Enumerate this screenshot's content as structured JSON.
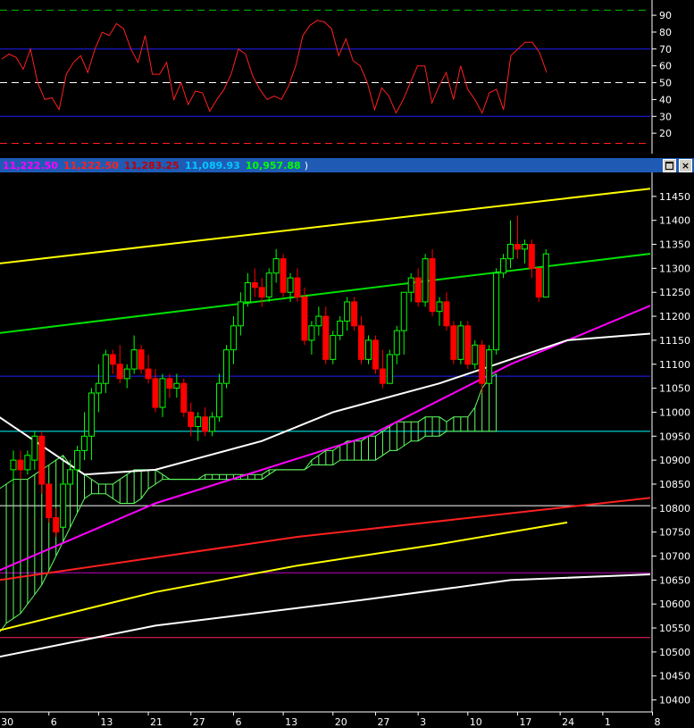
{
  "window": {
    "header_values": [
      {
        "text": "11,222.50",
        "color": "#ff00ff"
      },
      {
        "text": "11,222.50",
        "color": "#ff2020"
      },
      {
        "text": "11,283.25",
        "color": "#c00000"
      },
      {
        "text": "11,089.93",
        "color": "#00c8ff"
      },
      {
        "text": "10,957.88",
        "color": "#00ff00"
      }
    ],
    "header_close": ")",
    "maximize_icon": "maximize-icon",
    "close_icon": "close-icon"
  },
  "chart_data": [
    {
      "type": "line",
      "panel": "oscillator",
      "ylim": [
        10,
        98
      ],
      "yticks": [
        20,
        30,
        40,
        50,
        60,
        70,
        80,
        90
      ],
      "reference_lines": [
        {
          "y": 93,
          "color": "#00c000",
          "style": "dashed"
        },
        {
          "y": 70,
          "color": "#2020ff",
          "style": "solid"
        },
        {
          "y": 50,
          "color": "#ffffff",
          "style": "dashed"
        },
        {
          "y": 30,
          "color": "#2020ff",
          "style": "solid"
        },
        {
          "y": 14,
          "color": "#ff2020",
          "style": "dashed"
        }
      ],
      "series": [
        {
          "color": "#ff2020",
          "values": [
            64,
            67,
            65,
            58,
            70,
            50,
            40,
            41,
            34,
            55,
            62,
            66,
            56,
            70,
            80,
            78,
            85,
            82,
            70,
            62,
            78,
            55,
            55,
            62,
            40,
            50,
            37,
            45,
            44,
            33,
            40,
            46,
            55,
            70,
            67,
            54,
            46,
            40,
            42,
            40,
            48,
            60,
            78,
            84,
            87,
            86,
            82,
            66,
            76,
            63,
            60,
            50,
            34,
            47,
            42,
            32,
            40,
            50,
            60,
            60,
            38,
            48,
            56,
            40,
            60,
            46,
            40,
            32,
            44,
            46,
            34,
            66,
            70,
            74,
            74,
            68,
            56
          ]
        }
      ]
    },
    {
      "type": "candlestick",
      "panel": "price",
      "ylim": [
        10375,
        11500
      ],
      "yticks": [
        10400,
        10450,
        10500,
        10550,
        10600,
        10650,
        10700,
        10750,
        10800,
        10850,
        10900,
        10950,
        11000,
        11050,
        11100,
        11150,
        11200,
        11250,
        11300,
        11350,
        11400,
        11450
      ],
      "x_tick_labels": [
        "30",
        "6",
        "13",
        "21",
        "27",
        "6",
        "13",
        "20",
        "27",
        "3",
        "10",
        "17",
        "24",
        "1",
        "8"
      ],
      "x_tick_index": [
        -2,
        5,
        12,
        19,
        25,
        31,
        38,
        45,
        51,
        57,
        64,
        71,
        77,
        83,
        90
      ],
      "candles": [
        [
          10880,
          10920,
          10850,
          10900
        ],
        [
          10900,
          10920,
          10860,
          10880
        ],
        [
          10880,
          10920,
          10870,
          10910
        ],
        [
          10900,
          10960,
          10880,
          10950
        ],
        [
          10950,
          10960,
          10830,
          10850
        ],
        [
          10850,
          10850,
          10770,
          10780
        ],
        [
          10780,
          10800,
          10740,
          10750
        ],
        [
          10760,
          10860,
          10760,
          10850
        ],
        [
          10850,
          10900,
          10840,
          10880
        ],
        [
          10880,
          10930,
          10870,
          10920
        ],
        [
          10920,
          11000,
          10900,
          10950
        ],
        [
          10950,
          11050,
          10900,
          11040
        ],
        [
          11040,
          11100,
          11000,
          11060
        ],
        [
          11060,
          11130,
          11040,
          11120
        ],
        [
          11120,
          11130,
          11080,
          11100
        ],
        [
          11100,
          11140,
          11060,
          11070
        ],
        [
          11070,
          11100,
          11050,
          11090
        ],
        [
          11090,
          11160,
          11080,
          11130
        ],
        [
          11130,
          11140,
          11080,
          11090
        ],
        [
          11090,
          11120,
          11060,
          11070
        ],
        [
          11070,
          11090,
          11000,
          11010
        ],
        [
          11010,
          11080,
          10990,
          11070
        ],
        [
          11070,
          11080,
          11030,
          11050
        ],
        [
          11050,
          11080,
          11030,
          11060
        ],
        [
          11060,
          11070,
          10990,
          11000
        ],
        [
          11000,
          11020,
          10950,
          10970
        ],
        [
          10970,
          11000,
          10940,
          10990
        ],
        [
          10990,
          11010,
          10950,
          10960
        ],
        [
          10960,
          11000,
          10950,
          10990
        ],
        [
          10990,
          11080,
          10980,
          11060
        ],
        [
          11060,
          11140,
          11050,
          11130
        ],
        [
          11130,
          11200,
          11100,
          11180
        ],
        [
          11180,
          11250,
          11160,
          11230
        ],
        [
          11230,
          11290,
          11220,
          11270
        ],
        [
          11270,
          11300,
          11240,
          11260
        ],
        [
          11260,
          11280,
          11220,
          11240
        ],
        [
          11240,
          11300,
          11230,
          11290
        ],
        [
          11290,
          11340,
          11270,
          11320
        ],
        [
          11320,
          11330,
          11240,
          11250
        ],
        [
          11250,
          11290,
          11230,
          11280
        ],
        [
          11280,
          11300,
          11230,
          11240
        ],
        [
          11240,
          11260,
          11140,
          11150
        ],
        [
          11150,
          11190,
          11120,
          11180
        ],
        [
          11180,
          11220,
          11160,
          11200
        ],
        [
          11200,
          11220,
          11100,
          11110
        ],
        [
          11110,
          11170,
          11100,
          11160
        ],
        [
          11160,
          11200,
          11150,
          11190
        ],
        [
          11190,
          11240,
          11170,
          11230
        ],
        [
          11230,
          11240,
          11170,
          11180
        ],
        [
          11180,
          11200,
          11100,
          11110
        ],
        [
          11110,
          11160,
          11100,
          11150
        ],
        [
          11150,
          11160,
          11080,
          11090
        ],
        [
          11090,
          11130,
          11050,
          11060
        ],
        [
          11060,
          11130,
          11060,
          11120
        ],
        [
          11120,
          11180,
          11100,
          11170
        ],
        [
          11170,
          11210,
          11120,
          11250
        ],
        [
          11250,
          11290,
          11230,
          11280
        ],
        [
          11280,
          11300,
          11220,
          11230
        ],
        [
          11230,
          11330,
          11220,
          11320
        ],
        [
          11320,
          11340,
          11200,
          11210
        ],
        [
          11210,
          11240,
          11180,
          11230
        ],
        [
          11230,
          11250,
          11170,
          11180
        ],
        [
          11180,
          11190,
          11100,
          11110
        ],
        [
          11110,
          11190,
          11100,
          11180
        ],
        [
          11180,
          11190,
          11090,
          11100
        ],
        [
          11100,
          11150,
          11090,
          11140
        ],
        [
          11140,
          11150,
          11040,
          11060
        ],
        [
          11060,
          11140,
          11060,
          11130
        ],
        [
          11130,
          11300,
          11120,
          11290
        ],
        [
          11290,
          11330,
          11280,
          11320
        ],
        [
          11320,
          11400,
          11300,
          11350
        ],
        [
          11350,
          11410,
          11320,
          11340
        ],
        [
          11340,
          11360,
          11310,
          11350
        ],
        [
          11350,
          11360,
          11280,
          11300
        ],
        [
          11300,
          11300,
          11230,
          11240
        ],
        [
          11240,
          11340,
          11260,
          11330
        ]
      ],
      "lines": [
        {
          "name_color": "#ffff00",
          "width": 2,
          "points": [
            [
              -2,
              10545
            ],
            [
              20,
              10625
            ],
            [
              40,
              10680
            ],
            [
              60,
              10725
            ],
            [
              78,
              10770
            ]
          ]
        },
        {
          "name_color": "#ffffff",
          "width": 2,
          "points": [
            [
              -2,
              10490
            ],
            [
              20,
              10555
            ],
            [
              50,
              10610
            ],
            [
              70,
              10650
            ],
            [
              95,
              10665
            ]
          ]
        },
        {
          "name_color": "#ff2020",
          "width": 2,
          "points": [
            [
              -2,
              10650
            ],
            [
              40,
              10740
            ],
            [
              95,
              10830
            ]
          ]
        },
        {
          "name_color": "#ff00ff",
          "width": 2,
          "points": [
            [
              -2,
              10670
            ],
            [
              20,
              10810
            ],
            [
              50,
              10950
            ],
            [
              70,
              11100
            ],
            [
              95,
              11255
            ]
          ]
        },
        {
          "name_color": "#00e000",
          "width": 2,
          "points": [
            [
              -2,
              11165
            ],
            [
              95,
              11340
            ]
          ]
        },
        {
          "name_color": "#ffff00",
          "width": 2,
          "points": [
            [
              -2,
              11310
            ],
            [
              95,
              11475
            ]
          ]
        },
        {
          "name_color": "#ffffff",
          "width": 2,
          "points": [
            [
              -2,
              10990
            ],
            [
              10,
              10870
            ],
            [
              20,
              10880
            ],
            [
              35,
              10940
            ],
            [
              45,
              11000
            ],
            [
              60,
              11060
            ],
            [
              70,
              11110
            ],
            [
              78,
              11150
            ],
            [
              95,
              11170
            ]
          ]
        }
      ],
      "horizontal_lines": [
        {
          "y": 11075,
          "color": "#2020ff"
        },
        {
          "y": 10960,
          "color": "#00ffff"
        },
        {
          "y": 10805,
          "color": "#ffffff"
        },
        {
          "y": 10665,
          "color": "#c000c0"
        },
        {
          "y": 10530,
          "color": "#ff2060"
        }
      ],
      "cloud": {
        "x_start": -2,
        "span_a": [
          10840,
          10850,
          10860,
          10860,
          10860,
          10870,
          10880,
          10890,
          10900,
          10910,
          10890,
          10880,
          10870,
          10860,
          10850,
          10850,
          10850,
          10860,
          10870,
          10880,
          10880,
          10880,
          10880,
          10870,
          10860,
          10860,
          10860,
          10860,
          10860,
          10860,
          10860,
          10860,
          10860,
          10860,
          10860,
          10860,
          10860,
          10860,
          10870,
          10880,
          10880,
          10880,
          10880,
          10880,
          10900,
          10910,
          10920,
          10920,
          10930,
          10940,
          10940,
          10940,
          10950,
          10950,
          10960,
          10970,
          10980,
          10980,
          10980,
          10980,
          10990,
          10990,
          10990,
          10980,
          10990,
          10990,
          10990,
          11010,
          11050,
          11070,
          11080
        ],
        "span_b": [
          10540,
          10560,
          10570,
          10580,
          10600,
          10620,
          10640,
          10670,
          10700,
          10730,
          10760,
          10790,
          10820,
          10830,
          10830,
          10830,
          10820,
          10810,
          10810,
          10810,
          10820,
          10840,
          10850,
          10860,
          10860,
          10860,
          10860,
          10860,
          10860,
          10870,
          10870,
          10870,
          10870,
          10870,
          10870,
          10870,
          10870,
          10870,
          10880,
          10880,
          10880,
          10880,
          10880,
          10880,
          10890,
          10890,
          10890,
          10890,
          10900,
          10900,
          10900,
          10900,
          10900,
          10900,
          10910,
          10920,
          10920,
          10930,
          10940,
          10940,
          10950,
          10950,
          10950,
          10960,
          10960,
          10960,
          10960,
          10960,
          10960,
          10960,
          10960
        ]
      }
    }
  ]
}
